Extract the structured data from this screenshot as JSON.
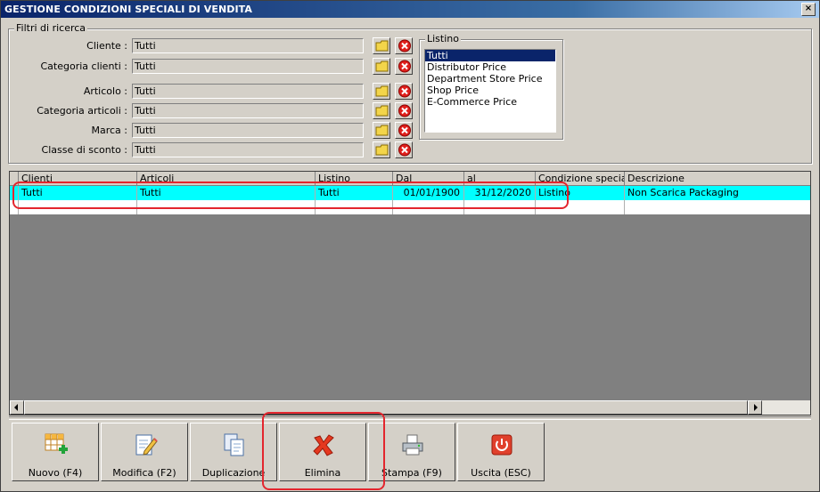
{
  "window": {
    "title": "GESTIONE CONDIZIONI SPECIALI DI VENDITA",
    "close_label": "×"
  },
  "filters": {
    "legend": "Filtri di ricerca",
    "fields": [
      {
        "label": "Cliente :",
        "value": "Tutti"
      },
      {
        "label": "Categoria clienti :",
        "value": "Tutti"
      },
      {
        "label": "Articolo :",
        "value": "Tutti"
      },
      {
        "label": "Categoria articoli :",
        "value": "Tutti"
      },
      {
        "label": "Marca :",
        "value": "Tutti"
      },
      {
        "label": "Classe di sconto :",
        "value": "Tutti"
      }
    ]
  },
  "listino": {
    "legend": "Listino",
    "options": [
      "Tutti",
      "Distributor Price",
      "Department Store Price",
      "Shop Price",
      "E-Commerce Price"
    ],
    "selected": "Tutti"
  },
  "grid": {
    "columns": [
      "Clienti",
      "Articoli",
      "Listino",
      "Dal",
      "al",
      "Condizione speciale",
      "Descrizione"
    ],
    "rows": [
      [
        "Tutti",
        "Tutti",
        "Tutti",
        "01/01/1900",
        "31/12/2020",
        "Listino",
        "Non Scarica Packaging"
      ]
    ]
  },
  "toolbar": {
    "buttons": [
      {
        "label": "Nuovo (F4)",
        "icon": "new-grid-icon"
      },
      {
        "label": "Modifica (F2)",
        "icon": "edit-document-icon"
      },
      {
        "label": "Duplicazione",
        "icon": "duplicate-icon"
      },
      {
        "label": "Elimina",
        "icon": "delete-x-icon"
      },
      {
        "label": "Stampa (F9)",
        "icon": "printer-icon"
      },
      {
        "label": "Uscita (ESC)",
        "icon": "power-icon"
      }
    ]
  },
  "colors": {
    "selected_row": "#00ffff",
    "highlight": "#e3262e",
    "titlebar": "#0a246a"
  }
}
